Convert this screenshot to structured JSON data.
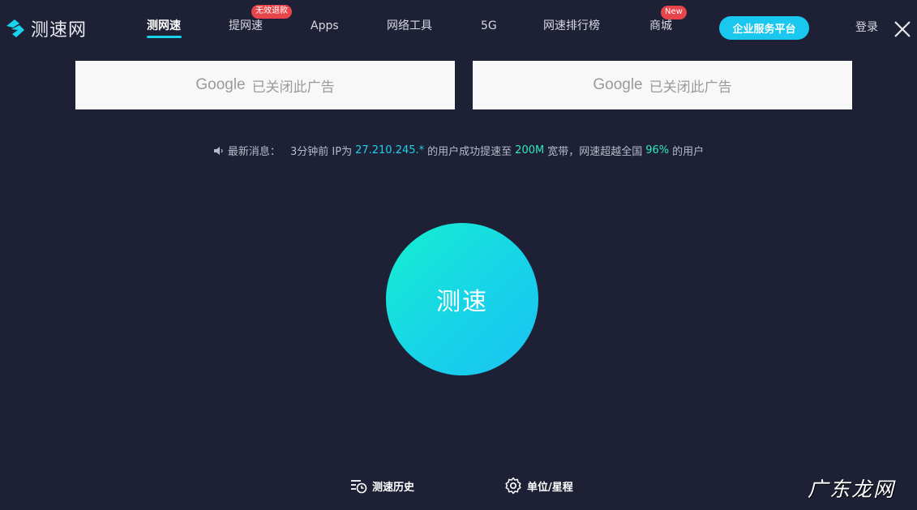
{
  "brand": {
    "name": "测速网"
  },
  "nav": {
    "items": [
      {
        "label": "测网速"
      },
      {
        "label": "提网速",
        "badge": "无效退款"
      },
      {
        "label": "Apps"
      },
      {
        "label": "网络工具"
      },
      {
        "label": "5G"
      },
      {
        "label": "网速排行榜"
      },
      {
        "label": "商城",
        "badge": "New"
      }
    ],
    "enterprise_label": "企业服务平台",
    "login_label": "登录"
  },
  "ads": [
    {
      "google": "Google",
      "closed_text": "已关闭此广告"
    },
    {
      "google": "Google",
      "closed_text": "已关闭此广告"
    }
  ],
  "news": {
    "prefix": "最新消息：",
    "time": "3分钟前 IP为",
    "ip": "27.210.245.*",
    "mid": "的用户成功提速至",
    "speed": "200M",
    "mid2": "宽带，网速超越全国",
    "percent": "96%",
    "suffix": "的用户"
  },
  "speed_test": {
    "label": "测速"
  },
  "bottom": {
    "history_label": "测速历史",
    "unit_label": "单位/星程"
  },
  "watermark": "广东龙网",
  "colors": {
    "background": "#1e2135",
    "accent": "#19d2ec",
    "badge": "#e8454b"
  }
}
